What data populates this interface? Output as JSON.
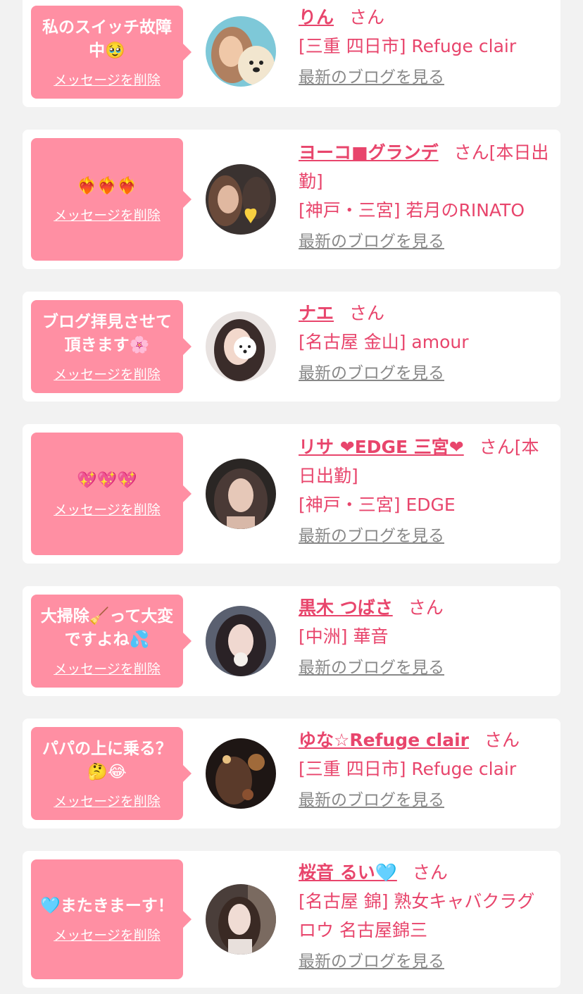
{
  "messages": [
    {
      "bubble_text": "私のスイッチ故障中🥹",
      "delete_label": "メッセージを削除",
      "name": "りん",
      "honorific": "さん",
      "location_shop": "[三重 四日市] Refuge clair",
      "blog_link": "最新のブログを見る",
      "avatar_icon": "photo-with-dog"
    },
    {
      "bubble_text": "❤️‍🔥❤️‍🔥❤️‍🔥",
      "delete_label": "メッセージを削除",
      "name": "ヨーコ■グランデ",
      "honorific": "さん[本日出勤]",
      "location_shop": "[神戸・三宮] 若月のRINATO",
      "blog_link": "最新のブログを見る",
      "avatar_icon": "photo-with-heart"
    },
    {
      "bubble_text": "ブログ拝見させて頂きます🌸",
      "delete_label": "メッセージを削除",
      "name": "ナエ",
      "honorific": "さん",
      "location_shop": "[名古屋 金山] amour",
      "blog_link": "最新のブログを見る",
      "avatar_icon": "photo-with-bear"
    },
    {
      "bubble_text": "💖💖💖",
      "delete_label": "メッセージを削除",
      "name": "リサ ❤EDGE 三宮❤",
      "honorific": "さん[本日出勤]",
      "location_shop": "[神戸・三宮] EDGE",
      "blog_link": "最新のブログを見る",
      "avatar_icon": "portrait-photo"
    },
    {
      "bubble_text": "大掃除🧹って大変ですよね💦",
      "delete_label": "メッセージを削除",
      "name": "黒木 つばさ",
      "honorific": "さん",
      "location_shop": "[中洲] 華音",
      "blog_link": "最新のブログを見る",
      "avatar_icon": "portrait-photo"
    },
    {
      "bubble_text": "パパの上に乗る？🤔😂",
      "delete_label": "メッセージを削除",
      "name": "ゆな☆Refuge clair",
      "honorific": "さん",
      "location_shop": "[三重 四日市] Refuge clair",
      "blog_link": "最新のブログを見る",
      "avatar_icon": "dark-photo"
    },
    {
      "bubble_text": "🩵またきまーす！",
      "delete_label": "メッセージを削除",
      "name": "桜音 るい🩵",
      "honorific": "さん",
      "location_shop": "[名古屋 錦] 熟女キャバクラグロウ 名古屋錦三",
      "blog_link": "最新のブログを見る",
      "avatar_icon": "portrait-photo"
    }
  ],
  "colors": {
    "accent_pink": "#e8456c",
    "bubble_pink": "#ff8fa3",
    "link_gray": "#888888",
    "page_bg": "#f2f2f2"
  }
}
